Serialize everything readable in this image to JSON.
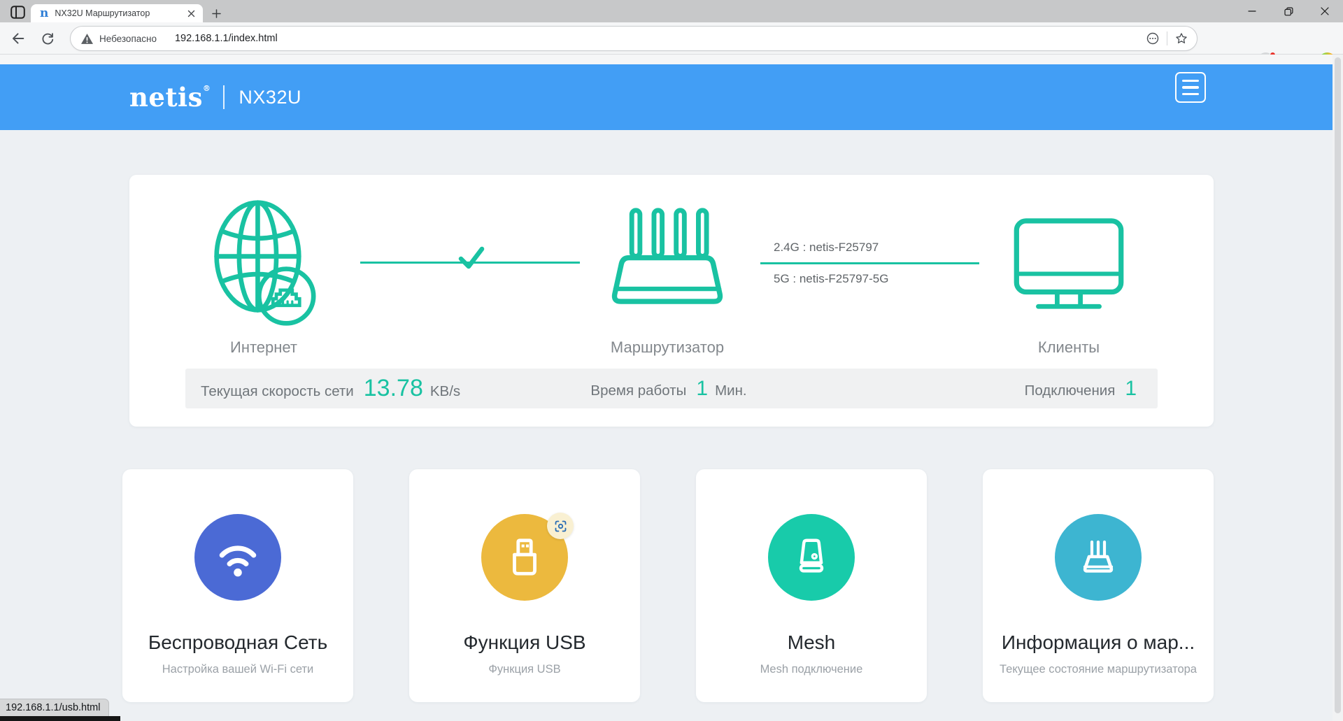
{
  "browser": {
    "tab": {
      "favicon_letter": "n",
      "title": "NX32U Маршрутизатор"
    },
    "address": {
      "security": "Небезопасно",
      "url": "192.168.1.1/index.html"
    },
    "status_tooltip": "192.168.1.1/usb.html"
  },
  "header": {
    "brand": "netis",
    "reg": "®",
    "model": "NX32U"
  },
  "status_card": {
    "internet_label": "Интернет",
    "router_label": "Маршрутизатор",
    "clients_label": "Клиенты",
    "ssid_24": "2.4G : netis-F25797",
    "ssid_5": "5G : netis-F25797-5G",
    "stats": {
      "speed_label": "Текущая скорость сети",
      "speed_value": "13.78",
      "speed_unit": "KB/s",
      "uptime_label": "Время работы",
      "uptime_value": "1",
      "uptime_unit": "Мин.",
      "conn_label": "Подключения",
      "conn_value": "1"
    }
  },
  "cards": [
    {
      "title": "Беспроводная Сеть",
      "subtitle": "Настройка вашей Wi-Fi сети",
      "color": "#4b6ad5",
      "icon": "wifi-icon"
    },
    {
      "title": "Функция USB",
      "subtitle": "Функция USB",
      "color": "#ecb93e",
      "icon": "usb-icon"
    },
    {
      "title": "Mesh",
      "subtitle": "Mesh подключение",
      "color": "#18cbaa",
      "icon": "mesh-node-icon"
    },
    {
      "title": "Информация о мар...",
      "subtitle": "Текущее состояние маршрутизатора",
      "color": "#3db5d1",
      "icon": "router-icon"
    }
  ],
  "colors": {
    "header_blue": "#429ef5",
    "accent_teal": "#19c2a2",
    "value_teal": "#19c2a2"
  }
}
